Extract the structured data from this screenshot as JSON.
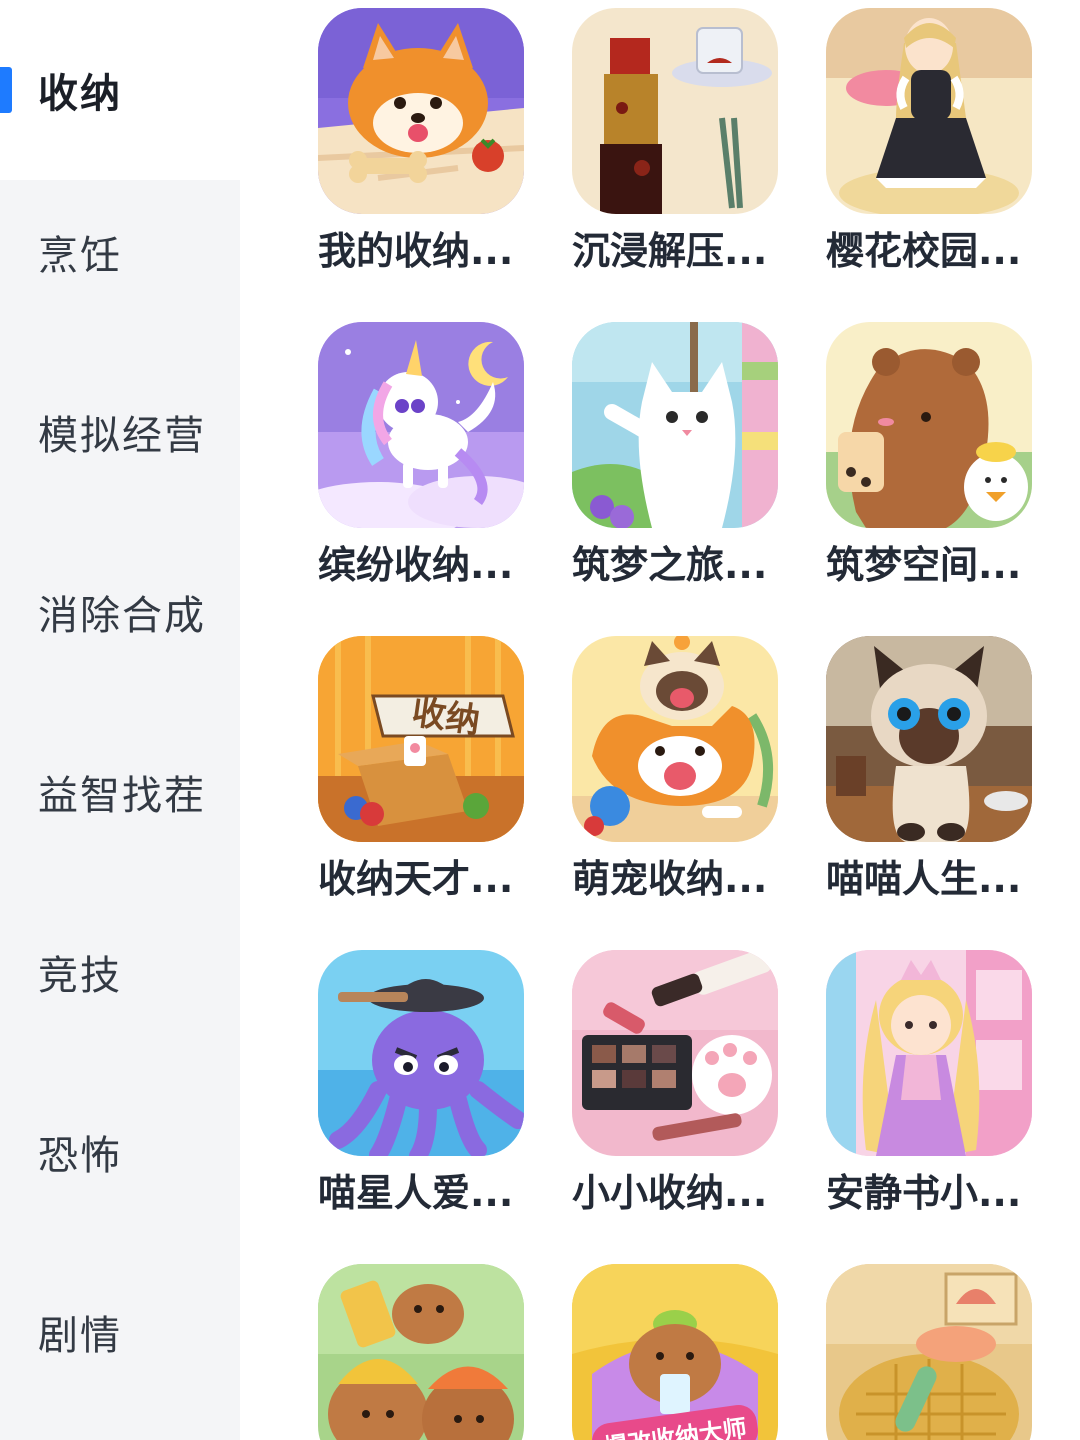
{
  "sidebar": {
    "categories": [
      {
        "label": "收纳",
        "active": true
      },
      {
        "label": "烹饪"
      },
      {
        "label": "模拟经营"
      },
      {
        "label": "消除合成"
      },
      {
        "label": "益智找茬"
      },
      {
        "label": "竞技"
      },
      {
        "label": "恐怖"
      },
      {
        "label": "剧情"
      }
    ],
    "accent_color": "#1e7bff"
  },
  "games": [
    {
      "label": "我的收纳...",
      "icon": "corgi-dog-icon"
    },
    {
      "label": "沉浸解压...",
      "icon": "lipstick-icon"
    },
    {
      "label": "樱花校园...",
      "icon": "anime-girl-icon"
    },
    {
      "label": "缤纷收纳...",
      "icon": "unicorn-icon"
    },
    {
      "label": "筑梦之旅...",
      "icon": "white-cat-icon"
    },
    {
      "label": "筑梦空间...",
      "icon": "capybara-icon"
    },
    {
      "label": "收纳天才...",
      "icon": "storage-box-icon",
      "icon_text": "收纳"
    },
    {
      "label": "萌宠收纳...",
      "icon": "cat-and-dog-icon"
    },
    {
      "label": "喵喵人生...",
      "icon": "siamese-cat-icon"
    },
    {
      "label": "喵星人爱...",
      "icon": "octopus-icon"
    },
    {
      "label": "小小收纳...",
      "icon": "makeup-palette-icon"
    },
    {
      "label": "安静书小...",
      "icon": "princess-icon"
    },
    {
      "label": "",
      "icon": "capybara-workers-icon"
    },
    {
      "label": "",
      "icon": "capybara-drink-icon",
      "icon_text": "爆改收纳大师"
    },
    {
      "label": "",
      "icon": "cozy-room-icon"
    }
  ]
}
